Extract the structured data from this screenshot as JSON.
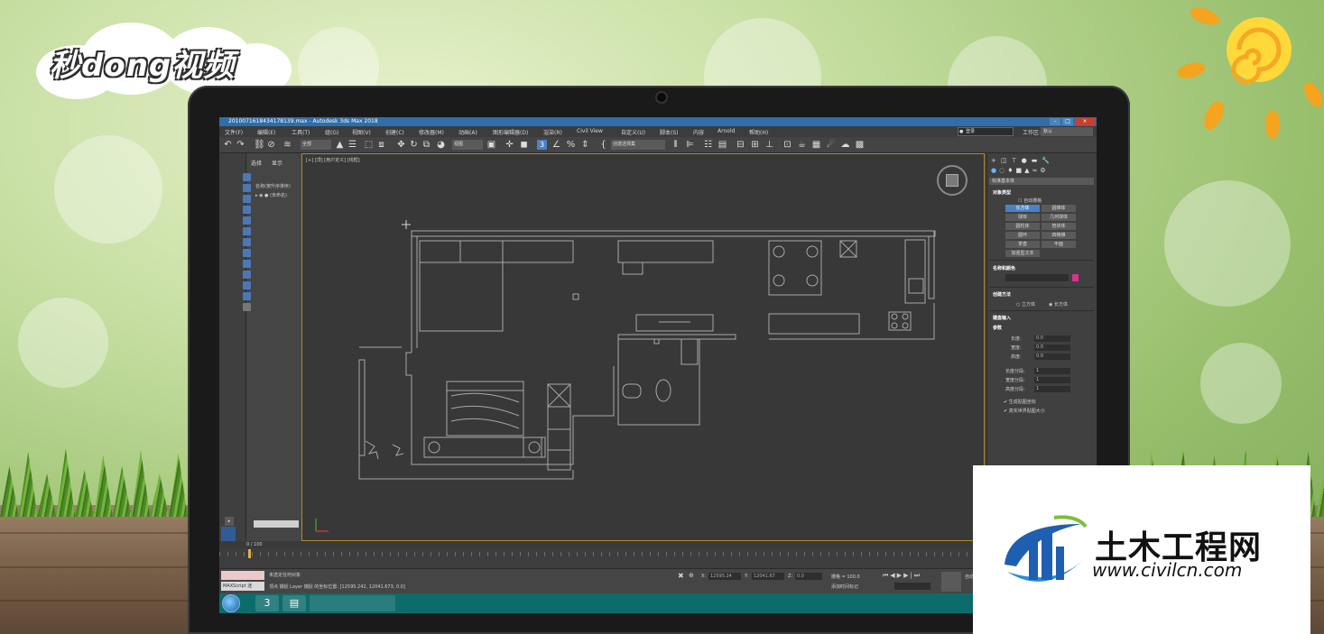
{
  "window": {
    "title": "201007161843417813​9.max - Autodesk 3ds Max 2018"
  },
  "menus": [
    "文件(F)",
    "编辑(E)",
    "工具(T)",
    "组(G)",
    "视图(V)",
    "创建(C)",
    "修改器(M)",
    "动画(A)",
    "图形编辑器(D)",
    "渲染(R)",
    "Civil View",
    "自定义(U)",
    "脚本(S)",
    "内容",
    "Arnold",
    "帮助(H)"
  ],
  "workspace": {
    "label": "工作区:",
    "value": "默认",
    "login": "登录"
  },
  "toolbar": {
    "selection_filter": "全部",
    "ref_coord": "视图",
    "named_set": "创建选择集"
  },
  "explorer": {
    "tabs": [
      "选择",
      "显示"
    ],
    "column_header": "名称(按升序排序)",
    "root_item": "(未命名)",
    "frame_readout": "0 / 100"
  },
  "viewport": {
    "label": "[+] [顶] [用户定义] [线框]"
  },
  "command_panel": {
    "category": "标准基本体",
    "object_type_header": "对象类型",
    "autogrid": "自动栅格",
    "primitives": [
      "长方体",
      "圆锥体",
      "球体",
      "几何球体",
      "圆柱体",
      "管状体",
      "圆环",
      "四棱锥",
      "茶壶",
      "平面",
      "加强型文本"
    ],
    "name_color_header": "名称和颜色",
    "swatch_color": "#d6348c",
    "creation_method_header": "创建方法",
    "creation_methods": [
      "立方体",
      "长方体"
    ],
    "keyboard_header": "键盘输入",
    "params_header": "参数",
    "params": [
      {
        "label": "长度:",
        "value": "0.0"
      },
      {
        "label": "宽度:",
        "value": "0.0"
      },
      {
        "label": "高度:",
        "value": "0.0"
      },
      {
        "label": "长度分段:",
        "value": "1"
      },
      {
        "label": "宽度分段:",
        "value": "1"
      },
      {
        "label": "高度分段:",
        "value": "1"
      }
    ],
    "checkboxes": [
      "生成贴图坐标",
      "真实世界贴图大小"
    ]
  },
  "status": {
    "maxscript": "MAXScript 迷",
    "line1": "未选定任何对象",
    "line2": "顶点 捕捉 Layer 捕捉 的坐标位置: [12595.242, 12041.673, 0.0]",
    "x_label": "X:",
    "x_value": "12595.24",
    "y_label": "Y:",
    "y_value": "12041.67",
    "z_label": "Z:",
    "z_value": "0.0",
    "grid": "栅格 = 100.0",
    "add_time_tag": "添加时间标记",
    "auto_key": "自动"
  },
  "branding": {
    "channel_logo": "秒dong视频",
    "watermark_title": "土木工程网",
    "watermark_url": "www.civilcn.com"
  },
  "colors": {
    "viewport_border": "#b68b2a",
    "taskbar": "#0d6b6b",
    "titlebar": "#2f6ea9",
    "active_button": "#4a82c4"
  }
}
